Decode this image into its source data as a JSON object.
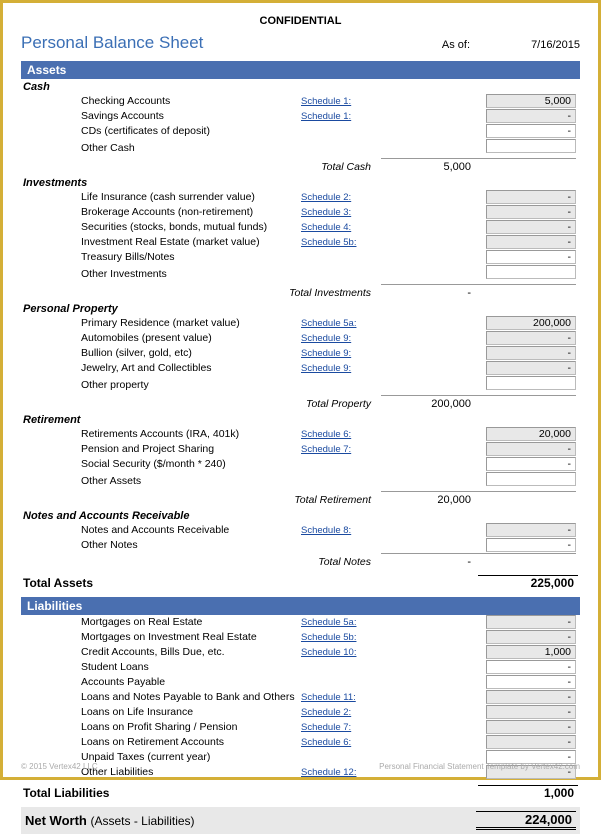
{
  "confidential": "CONFIDENTIAL",
  "title": "Personal Balance Sheet",
  "asof_label": "As of:",
  "asof_date": "7/16/2015",
  "assets": {
    "header": "Assets",
    "cash": {
      "title": "Cash",
      "items": [
        {
          "label": "Checking Accounts",
          "schedule": "Schedule 1:",
          "value": "5,000",
          "shaded": true
        },
        {
          "label": "Savings Accounts",
          "schedule": "Schedule 1:",
          "value": "-",
          "shaded": true
        },
        {
          "label": "CDs (certificates of deposit)",
          "schedule": "",
          "value": "-",
          "shaded": false
        },
        {
          "label": "Other Cash",
          "schedule": "",
          "value": "",
          "shaded": false
        }
      ],
      "subtotal_label": "Total Cash",
      "subtotal": "5,000"
    },
    "investments": {
      "title": "Investments",
      "items": [
        {
          "label": "Life Insurance (cash surrender value)",
          "schedule": "Schedule 2:",
          "value": "-",
          "shaded": true
        },
        {
          "label": "Brokerage Accounts (non-retirement)",
          "schedule": "Schedule 3:",
          "value": "-",
          "shaded": true
        },
        {
          "label": "Securities (stocks, bonds, mutual funds)",
          "schedule": "Schedule 4:",
          "value": "-",
          "shaded": true
        },
        {
          "label": "Investment Real Estate (market value)",
          "schedule": "Schedule 5b:",
          "value": "-",
          "shaded": true
        },
        {
          "label": "Treasury Bills/Notes",
          "schedule": "",
          "value": "-",
          "shaded": false
        },
        {
          "label": "Other Investments",
          "schedule": "",
          "value": "",
          "shaded": false
        }
      ],
      "subtotal_label": "Total Investments",
      "subtotal": "-"
    },
    "property": {
      "title": "Personal Property",
      "items": [
        {
          "label": "Primary Residence (market value)",
          "schedule": "Schedule 5a:",
          "value": "200,000",
          "shaded": true
        },
        {
          "label": "Automobiles (present value)",
          "schedule": "Schedule 9:",
          "value": "-",
          "shaded": true
        },
        {
          "label": "Bullion (silver, gold, etc)",
          "schedule": "Schedule 9:",
          "value": "-",
          "shaded": true
        },
        {
          "label": "Jewelry, Art and Collectibles",
          "schedule": "Schedule 9:",
          "value": "-",
          "shaded": true
        },
        {
          "label": "Other property",
          "schedule": "",
          "value": "",
          "shaded": false
        }
      ],
      "subtotal_label": "Total Property",
      "subtotal": "200,000"
    },
    "retirement": {
      "title": "Retirement",
      "items": [
        {
          "label": "Retirements Accounts (IRA, 401k)",
          "schedule": "Schedule 6:",
          "value": "20,000",
          "shaded": true
        },
        {
          "label": "Pension and Project Sharing",
          "schedule": "Schedule 7:",
          "value": "-",
          "shaded": true
        },
        {
          "label": "Social Security ($/month * 240)",
          "schedule": "",
          "value": "-",
          "shaded": false
        },
        {
          "label": "Other Assets",
          "schedule": "",
          "value": "",
          "shaded": false
        }
      ],
      "subtotal_label": "Total Retirement",
      "subtotal": "20,000"
    },
    "notes": {
      "title": "Notes and Accounts Receivable",
      "items": [
        {
          "label": "Notes and Accounts Receivable",
          "schedule": "Schedule 8:",
          "value": "-",
          "shaded": true
        },
        {
          "label": "Other Notes",
          "schedule": "",
          "value": "-",
          "shaded": false
        }
      ],
      "subtotal_label": "Total Notes",
      "subtotal": "-"
    },
    "total_label": "Total Assets",
    "total": "225,000"
  },
  "liabilities": {
    "header": "Liabilities",
    "items": [
      {
        "label": "Mortgages on Real Estate",
        "schedule": "Schedule 5a:",
        "value": "-",
        "shaded": true
      },
      {
        "label": "Mortgages on Investment Real Estate",
        "schedule": "Schedule 5b:",
        "value": "-",
        "shaded": true
      },
      {
        "label": "Credit Accounts, Bills Due, etc.",
        "schedule": "Schedule 10:",
        "value": "1,000",
        "shaded": true
      },
      {
        "label": "Student Loans",
        "schedule": "",
        "value": "-",
        "shaded": false
      },
      {
        "label": "Accounts Payable",
        "schedule": "",
        "value": "-",
        "shaded": false
      },
      {
        "label": "Loans and Notes Payable to Bank and Others",
        "schedule": "Schedule 11:",
        "value": "-",
        "shaded": true
      },
      {
        "label": "Loans on Life Insurance",
        "schedule": "Schedule 2:",
        "value": "-",
        "shaded": true
      },
      {
        "label": "Loans on Profit Sharing / Pension",
        "schedule": "Schedule 7:",
        "value": "-",
        "shaded": true
      },
      {
        "label": "Loans on Retirement Accounts",
        "schedule": "Schedule 6:",
        "value": "-",
        "shaded": true
      },
      {
        "label": "Unpaid Taxes (current year)",
        "schedule": "",
        "value": "-",
        "shaded": false
      },
      {
        "label": "Other Liabilities",
        "schedule": "Schedule 12:",
        "value": "-",
        "shaded": true
      }
    ],
    "total_label": "Total Liabilities",
    "total": "1,000"
  },
  "networth": {
    "label": "Net Worth",
    "sublabel": "(Assets - Liabilities)",
    "value": "224,000"
  },
  "footer": {
    "left": "© 2015 Vertex42 LLC",
    "right": "Personal Financial Statement Template by Vertex42.com"
  }
}
